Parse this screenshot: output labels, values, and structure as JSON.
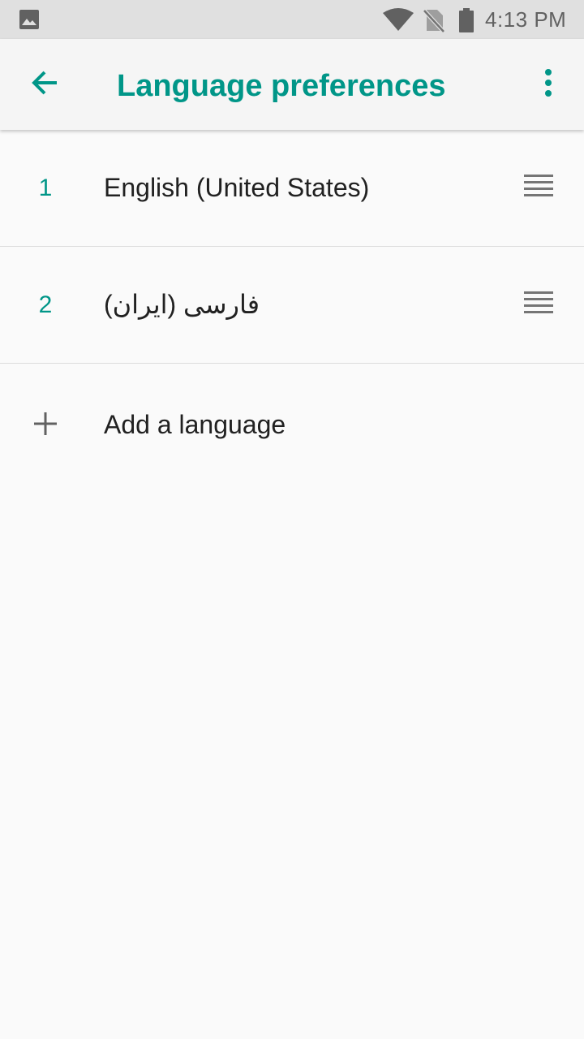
{
  "status_bar": {
    "time": "4:13 PM",
    "icons": [
      "image-icon",
      "wifi-icon",
      "no-sim-icon",
      "battery-icon"
    ]
  },
  "app_bar": {
    "title": "Language preferences",
    "back_icon": "arrow-back-icon",
    "menu_icon": "more-vert-icon"
  },
  "languages": [
    {
      "number": "1",
      "name": "English (United States)",
      "handle_icon": "drag-handle-icon"
    },
    {
      "number": "2",
      "name": "فارسی (ایران)",
      "handle_icon": "drag-handle-icon"
    }
  ],
  "add_language": {
    "label": "Add a language",
    "icon": "plus-icon"
  },
  "colors": {
    "accent": "#009688",
    "status_bar": "#e0e0e0",
    "app_bar": "#f5f5f5",
    "background": "#fafafa",
    "text": "#212121",
    "icon_gray": "#616161"
  }
}
